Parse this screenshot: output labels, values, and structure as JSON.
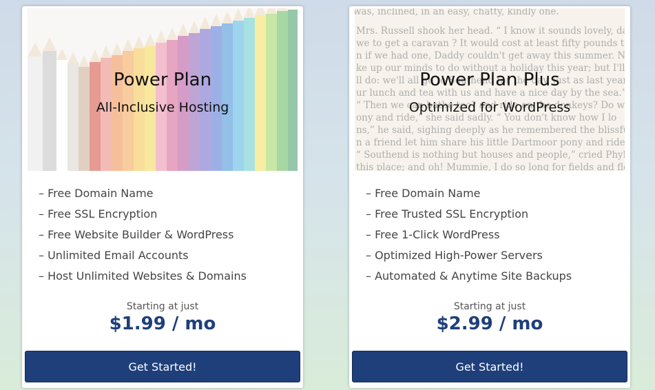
{
  "plans": [
    {
      "title": "Power Plan",
      "subtitle": "All-Inclusive Hosting",
      "features": [
        "– Free Domain Name",
        "– Free SSL Encryption",
        "– Free Website Builder & WordPress",
        "– Unlimited Email Accounts",
        "– Host Unlimited Websites & Domains"
      ],
      "starting_label": "Starting at just",
      "price": "$1.99 / mo",
      "cta_label": "Get Started!"
    },
    {
      "title": "Power Plan Plus",
      "subtitle": "Optimized for WordPress",
      "features": [
        "– Free Domain Name",
        "– Free Trusted SSL Encryption",
        "– Free 1-Click WordPress",
        "– Optimized High-Power Servers",
        "– Automated & Anytime Site Backups"
      ],
      "starting_label": "Starting at just",
      "price": "$2.99 / mo",
      "cta_label": "Get Started!"
    }
  ],
  "colors": {
    "accent": "#1e3f7a",
    "page_bg_top": "#cfdbe8",
    "page_bg_bottom": "#d9ecd9"
  },
  "images": {
    "plan1_hero": "colored-pencils-photo",
    "plan2_hero": "old-book-page-photo"
  }
}
